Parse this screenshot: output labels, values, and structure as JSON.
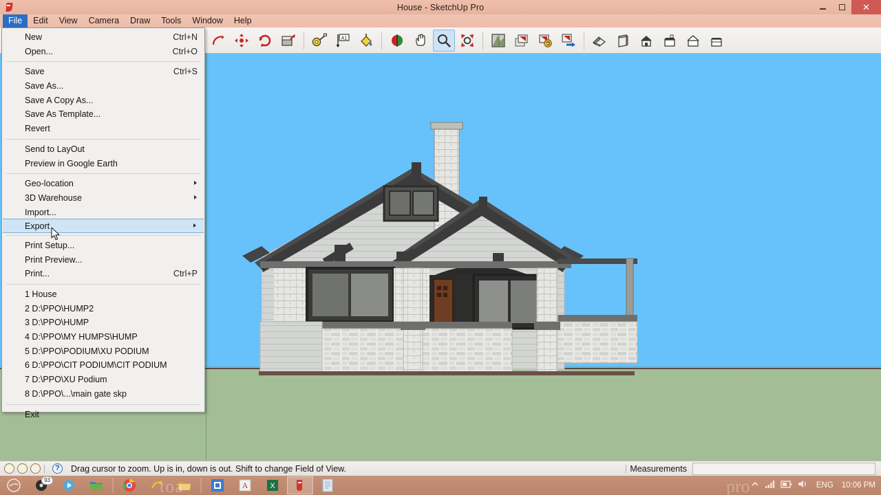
{
  "window": {
    "title": "House - SketchUp Pro",
    "app_icon": "sketchup-icon",
    "minimize_label": "Minimize",
    "maximize_label": "Restore",
    "close_label": "Close"
  },
  "menubar": {
    "items": [
      {
        "label": "File",
        "active": true
      },
      {
        "label": "Edit",
        "active": false
      },
      {
        "label": "View",
        "active": false
      },
      {
        "label": "Camera",
        "active": false
      },
      {
        "label": "Draw",
        "active": false
      },
      {
        "label": "Tools",
        "active": false
      },
      {
        "label": "Window",
        "active": false
      },
      {
        "label": "Help",
        "active": false
      }
    ]
  },
  "toolbar": {
    "groups": [
      {
        "buttons": [
          {
            "name": "arc-tool",
            "active": false
          },
          {
            "name": "move-tool",
            "active": false
          },
          {
            "name": "rotate-tool",
            "active": false
          },
          {
            "name": "push-pull-tool",
            "active": false
          }
        ]
      },
      {
        "buttons": [
          {
            "name": "tape-measure-tool",
            "active": false
          },
          {
            "name": "dimension-tool",
            "active": false
          },
          {
            "name": "paint-bucket-tool",
            "active": false
          }
        ]
      },
      {
        "buttons": [
          {
            "name": "section-plane-tool",
            "active": false
          },
          {
            "name": "pan-tool",
            "active": false
          },
          {
            "name": "zoom-tool",
            "active": true
          },
          {
            "name": "zoom-extents-tool",
            "active": false
          }
        ]
      },
      {
        "buttons": [
          {
            "name": "position-camera-tool",
            "active": false
          },
          {
            "name": "add-scene-tool",
            "active": false
          },
          {
            "name": "update-scene-tool",
            "active": false
          },
          {
            "name": "export-scene-tool",
            "active": false
          }
        ]
      },
      {
        "buttons": [
          {
            "name": "iso-view-button",
            "active": false
          },
          {
            "name": "top-view-button",
            "active": false
          },
          {
            "name": "front-view-button",
            "active": false
          },
          {
            "name": "right-view-button",
            "active": false
          },
          {
            "name": "back-view-button",
            "active": false
          },
          {
            "name": "left-view-button",
            "active": false
          }
        ]
      }
    ]
  },
  "file_menu": {
    "sections": [
      {
        "items": [
          {
            "label": "New",
            "accel": "Ctrl+N",
            "submenu": false,
            "selected": false
          },
          {
            "label": "Open...",
            "accel": "Ctrl+O",
            "submenu": false,
            "selected": false
          }
        ]
      },
      {
        "items": [
          {
            "label": "Save",
            "accel": "Ctrl+S",
            "submenu": false,
            "selected": false
          },
          {
            "label": "Save As...",
            "accel": "",
            "submenu": false,
            "selected": false
          },
          {
            "label": "Save A Copy As...",
            "accel": "",
            "submenu": false,
            "selected": false
          },
          {
            "label": "Save As Template...",
            "accel": "",
            "submenu": false,
            "selected": false
          },
          {
            "label": "Revert",
            "accel": "",
            "submenu": false,
            "selected": false
          }
        ]
      },
      {
        "items": [
          {
            "label": "Send to LayOut",
            "accel": "",
            "submenu": false,
            "selected": false
          },
          {
            "label": "Preview in Google Earth",
            "accel": "",
            "submenu": false,
            "selected": false
          }
        ]
      },
      {
        "items": [
          {
            "label": "Geo-location",
            "accel": "",
            "submenu": true,
            "selected": false
          },
          {
            "label": "3D Warehouse",
            "accel": "",
            "submenu": true,
            "selected": false
          },
          {
            "label": "Import...",
            "accel": "",
            "submenu": false,
            "selected": false
          },
          {
            "label": "Export",
            "accel": "",
            "submenu": true,
            "selected": true
          }
        ]
      },
      {
        "items": [
          {
            "label": "Print Setup...",
            "accel": "",
            "submenu": false,
            "selected": false
          },
          {
            "label": "Print Preview...",
            "accel": "",
            "submenu": false,
            "selected": false
          },
          {
            "label": "Print...",
            "accel": "Ctrl+P",
            "submenu": false,
            "selected": false
          }
        ]
      },
      {
        "items": [
          {
            "label": "1 House",
            "accel": "",
            "submenu": false,
            "selected": false
          },
          {
            "label": "2 D:\\PPO\\HUMP2",
            "accel": "",
            "submenu": false,
            "selected": false
          },
          {
            "label": "3 D:\\PPO\\HUMP",
            "accel": "",
            "submenu": false,
            "selected": false
          },
          {
            "label": "4 D:\\PPO\\MY HUMPS\\HUMP",
            "accel": "",
            "submenu": false,
            "selected": false
          },
          {
            "label": "5 D:\\PPO\\PODIUM\\XU PODIUM",
            "accel": "",
            "submenu": false,
            "selected": false
          },
          {
            "label": "6 D:\\PPO\\CIT PODIUM\\CIT PODIUM",
            "accel": "",
            "submenu": false,
            "selected": false
          },
          {
            "label": "7 D:\\PPO\\XU Podium",
            "accel": "",
            "submenu": false,
            "selected": false
          },
          {
            "label": "8 D:\\PPO\\...\\main gate skp",
            "accel": "",
            "submenu": false,
            "selected": false
          }
        ]
      },
      {
        "items": [
          {
            "label": "Exit",
            "accel": "",
            "submenu": false,
            "selected": false
          }
        ]
      }
    ]
  },
  "viewport": {
    "model_name": "house-model",
    "sky_color": "#67c2fb",
    "ground_color": "#a3bd96",
    "siding_color": "#d2d4d2",
    "roof_color": "#4a4a4a",
    "stone_color": "#e3e3e0",
    "door_color": "#6b3a22"
  },
  "statusbar": {
    "icons": [
      "person-icon",
      "person-pin-icon",
      "refresh-person-icon",
      "help-icon"
    ],
    "hint": "Drag cursor to zoom.  Up is in, down is out. Shift to change Field of View.",
    "measurements_label": "Measurements",
    "measurements_value": "",
    "measurements_placeholder": ""
  },
  "taskbar": {
    "items": [
      {
        "name": "taskbar-start-icon",
        "badge": ""
      },
      {
        "name": "taskbar-media-icon",
        "badge": "93"
      },
      {
        "name": "taskbar-player-icon",
        "badge": ""
      },
      {
        "name": "taskbar-folder-icon",
        "badge": ""
      },
      {
        "name": "taskbar-chrome-icon",
        "badge": ""
      },
      {
        "name": "taskbar-sketchup-make-icon",
        "badge": ""
      },
      {
        "name": "taskbar-explorer-icon",
        "badge": ""
      },
      {
        "name": "taskbar-layout-icon",
        "badge": ""
      },
      {
        "name": "taskbar-word-icon",
        "badge": ""
      },
      {
        "name": "taskbar-excel-icon",
        "badge": ""
      },
      {
        "name": "taskbar-sketchup-pro-icon",
        "badge": ""
      },
      {
        "name": "taskbar-notepad-icon",
        "badge": ""
      }
    ],
    "tray": {
      "show_hidden_icon": "chevron-up-icon",
      "network_icon": "signal-icon",
      "battery_icon": "battery-icon",
      "volume_icon": "volume-icon",
      "language": "ENG",
      "clock": "10:06 PM"
    },
    "watermark_left": "toa",
    "watermark_right": "pro"
  }
}
